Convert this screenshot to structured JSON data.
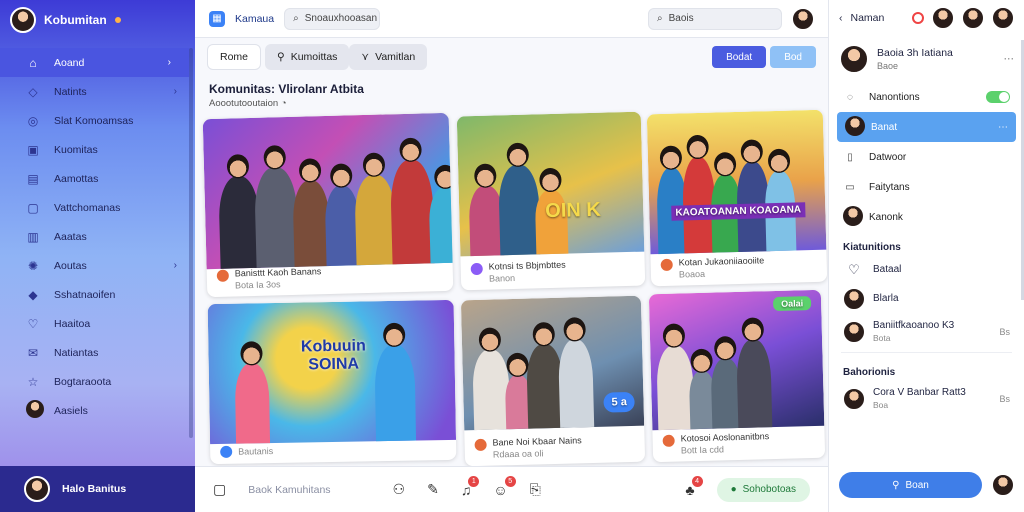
{
  "sidebar": {
    "title": "Kobumitan",
    "items": [
      {
        "label": "Aoand",
        "icon": "home-icon",
        "glyph": "⌂",
        "chev": "›",
        "active": true
      },
      {
        "label": "Natints",
        "icon": "tag-icon",
        "glyph": "◇",
        "chev": "›"
      },
      {
        "label": "Slat Komoamsas",
        "icon": "compass-icon",
        "glyph": "◎",
        "chev": ""
      },
      {
        "label": "Kuomitas",
        "icon": "chart-icon",
        "glyph": "▣",
        "chev": ""
      },
      {
        "label": "Aamottas",
        "icon": "calendar-icon",
        "glyph": "▤",
        "chev": ""
      },
      {
        "label": "Vattchomanas",
        "icon": "video-icon",
        "glyph": "▢",
        "chev": ""
      },
      {
        "label": "Aaatas",
        "icon": "doc-icon",
        "glyph": "▥",
        "chev": ""
      },
      {
        "label": "Aoutas",
        "icon": "globe-icon",
        "glyph": "✺",
        "chev": "›"
      },
      {
        "label": "Sshatnaoifen",
        "icon": "cube-icon",
        "glyph": "◆",
        "chev": ""
      },
      {
        "label": "Haaitoa",
        "icon": "heart-icon",
        "glyph": "♡",
        "chev": ""
      },
      {
        "label": "Natiantas",
        "icon": "mail-icon",
        "glyph": "✉",
        "chev": ""
      },
      {
        "label": "Bogtaraoota",
        "icon": "star-icon",
        "glyph": "☆",
        "chev": ""
      },
      {
        "label": "Aasiels",
        "icon": "person-icon",
        "glyph": "",
        "chev": ""
      }
    ],
    "footer_name": "Halo Banitus"
  },
  "topbar": {
    "app_name": "Kamaua",
    "search1": "Snoauxhooasan",
    "search2": "Baois"
  },
  "tabs": {
    "home": "Rome",
    "group": [
      "Kumoittas",
      "Vamitlan"
    ],
    "btn1": "Bodat",
    "btn2": "Bod"
  },
  "section": {
    "title": "Komunitas: Vlirolanr Atbita",
    "sub": "Aoootutooutaion"
  },
  "cards": [
    {
      "title": "Banisttt Kaoh Banans",
      "sub": "Bota Ia 3os"
    },
    {
      "title": "Kotnsi ts Bbjmbttes",
      "sub": "Banon"
    },
    {
      "title": "Kotan Jukaoniiaooiite",
      "sub": "Boaoa"
    },
    {
      "title": "Bautanis",
      "sub": ""
    },
    {
      "title": "Bane Noi Kbaar Nains",
      "sub": "Rdaaa oa oli"
    },
    {
      "title": "Kotosoi Aoslonanitbns",
      "sub": "Bott Ia cdd"
    }
  ],
  "card_overlays": {
    "c2": "OIN K",
    "c3": "KAOATOANAN KOAOANA",
    "c4": "Kobuuin SOINA",
    "c5": "5 a",
    "c6": "Oalai"
  },
  "bottombar": {
    "text": "Baok Kamuhitans",
    "pill": "Sohobotoas",
    "badges": [
      "1",
      "5",
      "4"
    ]
  },
  "right": {
    "title": "Naman",
    "profile_name": "Baoia 3h Iatiana",
    "profile_sub": "Baoe",
    "items": [
      {
        "label": "Nanontions",
        "icon": "search-icon",
        "glyph": "◌"
      },
      {
        "label": "Banat",
        "icon": "avatar-icon",
        "glyph": "",
        "active": true
      },
      {
        "label": "Datwoor",
        "icon": "doc-icon",
        "glyph": "▯"
      },
      {
        "label": "Faitytans",
        "icon": "chat-icon",
        "glyph": "▭"
      },
      {
        "label": "Kanonk",
        "icon": "avatar-icon",
        "glyph": ""
      }
    ],
    "section1": "Kiatunitions",
    "contacts1": [
      {
        "name": "Bataal",
        "sub": "",
        "icon": "heart-icon"
      },
      {
        "name": "Blarla",
        "sub": "",
        "icon": "avatar-icon"
      },
      {
        "name": "Baniitfkaoanoo K3",
        "sub": "Bota",
        "end": "Bs"
      }
    ],
    "section2": "Bahorionis",
    "contacts2": [
      {
        "name": "Cora V Banbar Ratt3",
        "sub": "Boa",
        "end": "Bs"
      }
    ],
    "footer_btn": "Boan"
  }
}
